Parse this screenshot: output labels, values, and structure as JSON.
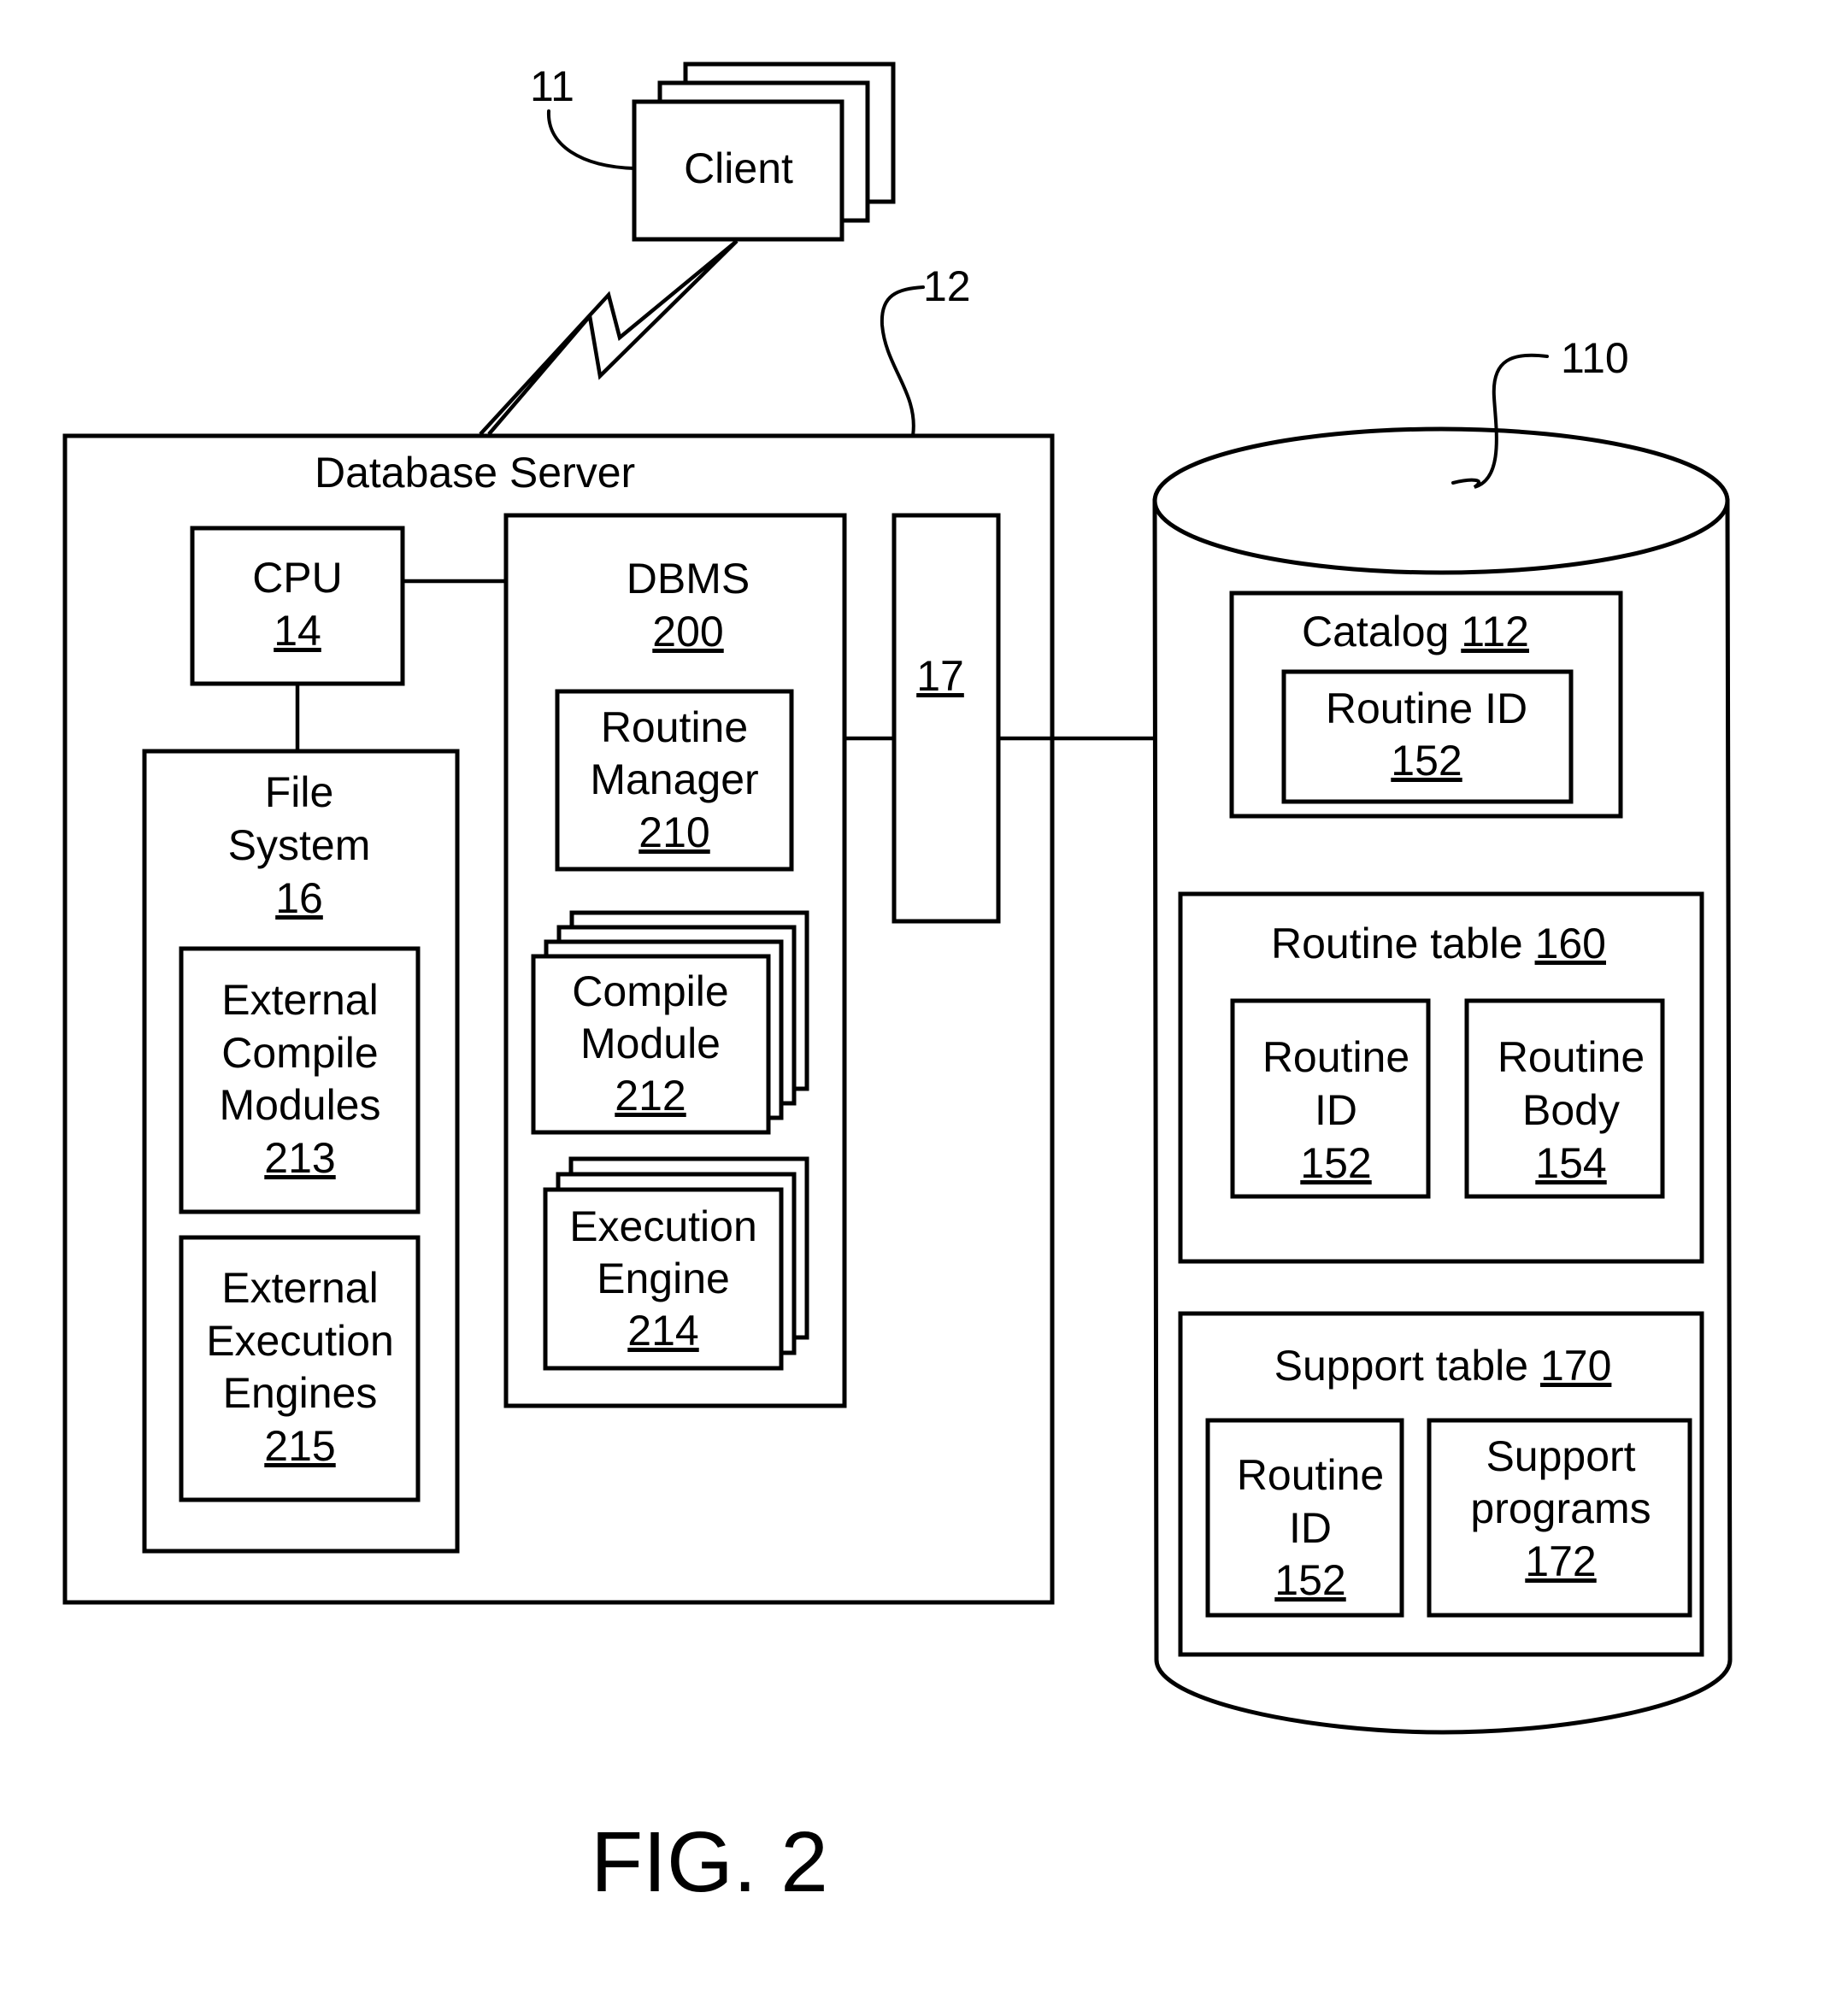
{
  "figure_label": "FIG. 2",
  "client": {
    "label": "Client",
    "ref": "11"
  },
  "database_server": {
    "label": "Database Server",
    "ref": "12",
    "cpu": {
      "label": "CPU",
      "ref": "14"
    },
    "file_system": {
      "label_line1": "File",
      "label_line2": "System",
      "ref": "16",
      "external_compile_modules": {
        "line1": "External",
        "line2": "Compile",
        "line3": "Modules",
        "ref": "213"
      },
      "external_execution_engines": {
        "line1": "External",
        "line2": "Execution",
        "line3": "Engines",
        "ref": "215"
      }
    },
    "dbms": {
      "label": "DBMS",
      "ref": "200",
      "routine_manager": {
        "line1": "Routine",
        "line2": "Manager",
        "ref": "210"
      },
      "compile_module": {
        "line1": "Compile",
        "line2": "Module",
        "ref": "212"
      },
      "execution_engine": {
        "line1": "Execution",
        "line2": "Engine",
        "ref": "214"
      }
    },
    "interface": {
      "ref": "17"
    }
  },
  "database": {
    "ref": "110",
    "catalog": {
      "label": "Catalog",
      "ref": "112",
      "routine_id": {
        "label": "Routine ID",
        "ref": "152"
      }
    },
    "routine_table": {
      "label": "Routine table",
      "ref": "160",
      "routine_id": {
        "line1": "Routine",
        "line2": "ID",
        "ref": "152"
      },
      "routine_body": {
        "line1": "Routine",
        "line2": "Body",
        "ref": "154"
      }
    },
    "support_table": {
      "label": "Support table",
      "ref": "170",
      "routine_id": {
        "line1": "Routine",
        "line2": "ID",
        "ref": "152"
      },
      "support_programs": {
        "line1": "Support",
        "line2": "programs",
        "ref": "172"
      }
    }
  }
}
